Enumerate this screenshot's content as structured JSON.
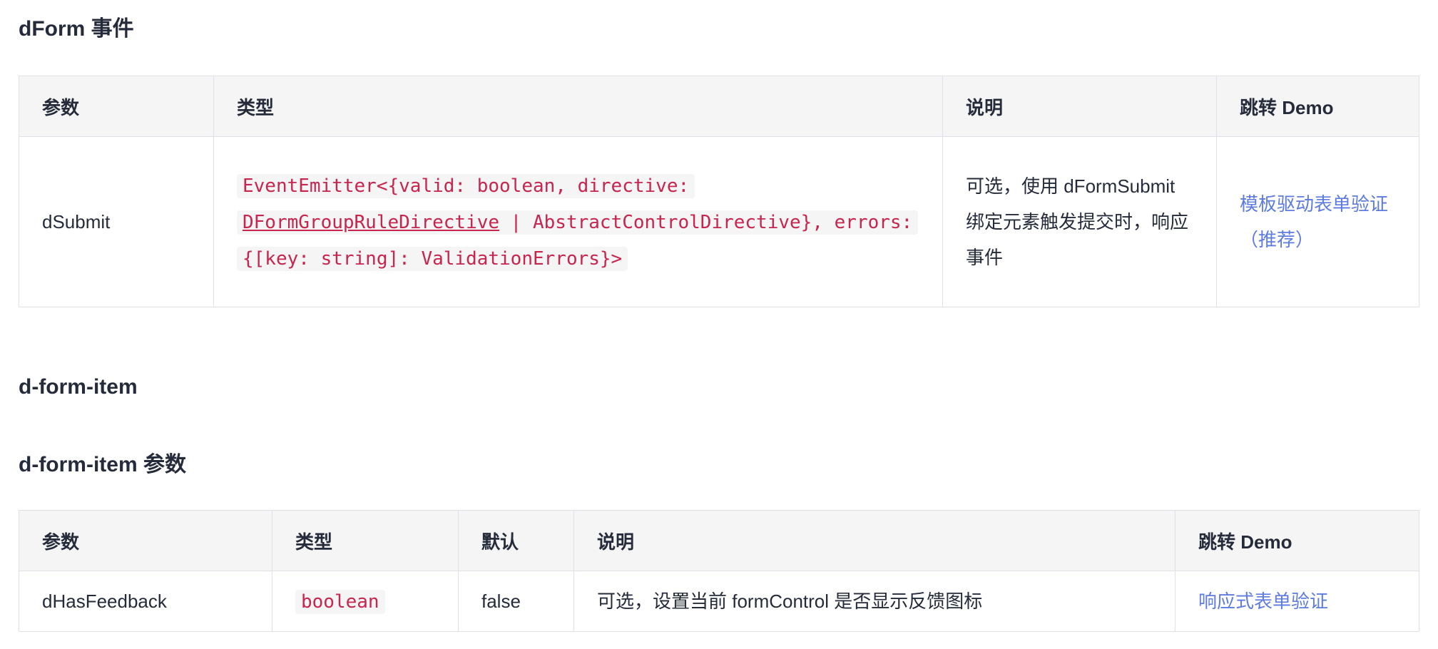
{
  "events_section": {
    "title": "dForm 事件",
    "headers": [
      "参数",
      "类型",
      "说明",
      "跳转 Demo"
    ],
    "row": {
      "param": "dSubmit",
      "type_parts": {
        "part1": "EventEmitter<{valid: boolean, directive: ",
        "link": "DFormGroupRuleDirective",
        "part2": " | AbstractControlDirective}, errors: {[key: string]: ValidationErrors}>"
      },
      "description": "可选，使用 dFormSubmit 绑定元素触发提交时，响应事件",
      "demo": "模板驱动表单验证（推荐）"
    }
  },
  "item_section": {
    "title": "d-form-item"
  },
  "params_section": {
    "title": "d-form-item 参数",
    "headers": [
      "参数",
      "类型",
      "默认",
      "说明",
      "跳转 Demo"
    ],
    "row": {
      "param": "dHasFeedback",
      "type": "boolean",
      "default": "false",
      "description": "可选，设置当前 formControl 是否显示反馈图标",
      "demo": "响应式表单验证"
    }
  },
  "colors": {
    "text": "#252b3a",
    "code_text": "#c7254e",
    "code_bg": "#f5f5f5",
    "link": "#5e7ce0",
    "header_bg": "#f5f5f5",
    "border": "#dfe1e6"
  }
}
